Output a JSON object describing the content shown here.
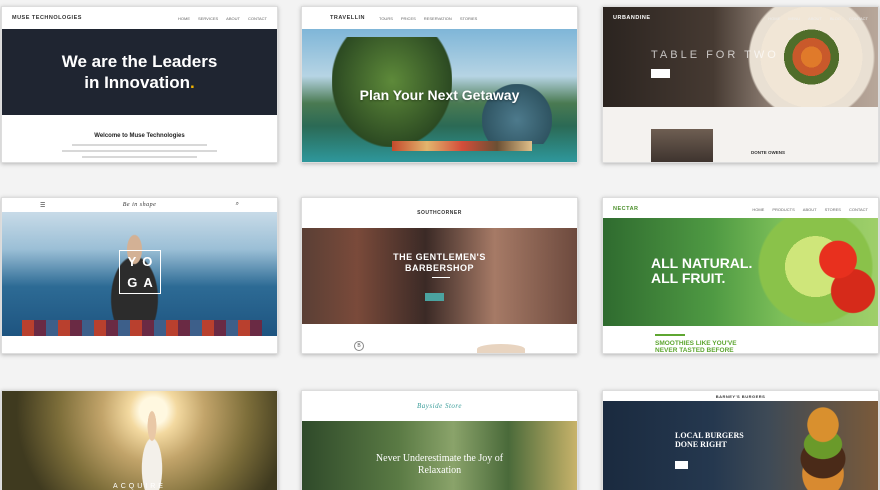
{
  "cards": [
    {
      "logo": "MUSE TECHNOLOGIES",
      "nav": [
        "HOME",
        "SERVICES",
        "ABOUT",
        "CONTACT"
      ],
      "title_line1": "We are the Leaders",
      "title_line2": "in Innovation",
      "title_dot": ".",
      "section_title": "Welcome to Muse Technologies"
    },
    {
      "logo": "TRAVELLIN",
      "nav": [
        "TOURS",
        "PRICES",
        "RESERVATION",
        "STORIES"
      ],
      "title": "Plan Your Next Getaway"
    },
    {
      "logo": "URBANDINE",
      "nav": [
        "HOME",
        "MENU",
        "ABOUT",
        "BLOG",
        "CONTACT"
      ],
      "title": "TABLE FOR TWO",
      "chef": "DONTE OWENS"
    },
    {
      "logo": "Be in shape",
      "letters": [
        "Y",
        "O",
        "G",
        "A"
      ],
      "menu_icon": "☰",
      "search_icon": "⌕"
    },
    {
      "logo": "SOUTHCORNER",
      "title_line1": "THE GENTLEMEN'S",
      "title_line2": "BARBERSHOP",
      "badge": "B"
    },
    {
      "logo": "NECTAR",
      "nav": [
        "HOME",
        "PRODUCTS",
        "ABOUT",
        "STORES",
        "CONTACT"
      ],
      "title_line1": "ALL NATURAL.",
      "title_line2": "ALL FRUIT.",
      "sub_line1": "SMOOTHIES LIKE YOU'VE",
      "sub_line2": "NEVER TASTED BEFORE"
    },
    {
      "title": "ACQUIRE"
    },
    {
      "logo": "Bayside Store",
      "title_line1": "Never Underestimate the Joy of",
      "title_line2": "Relaxation"
    },
    {
      "logo": "BARNEY'S BURGERS",
      "title_line1": "LOCAL BURGERS",
      "title_line2": "DONE RIGHT"
    }
  ]
}
